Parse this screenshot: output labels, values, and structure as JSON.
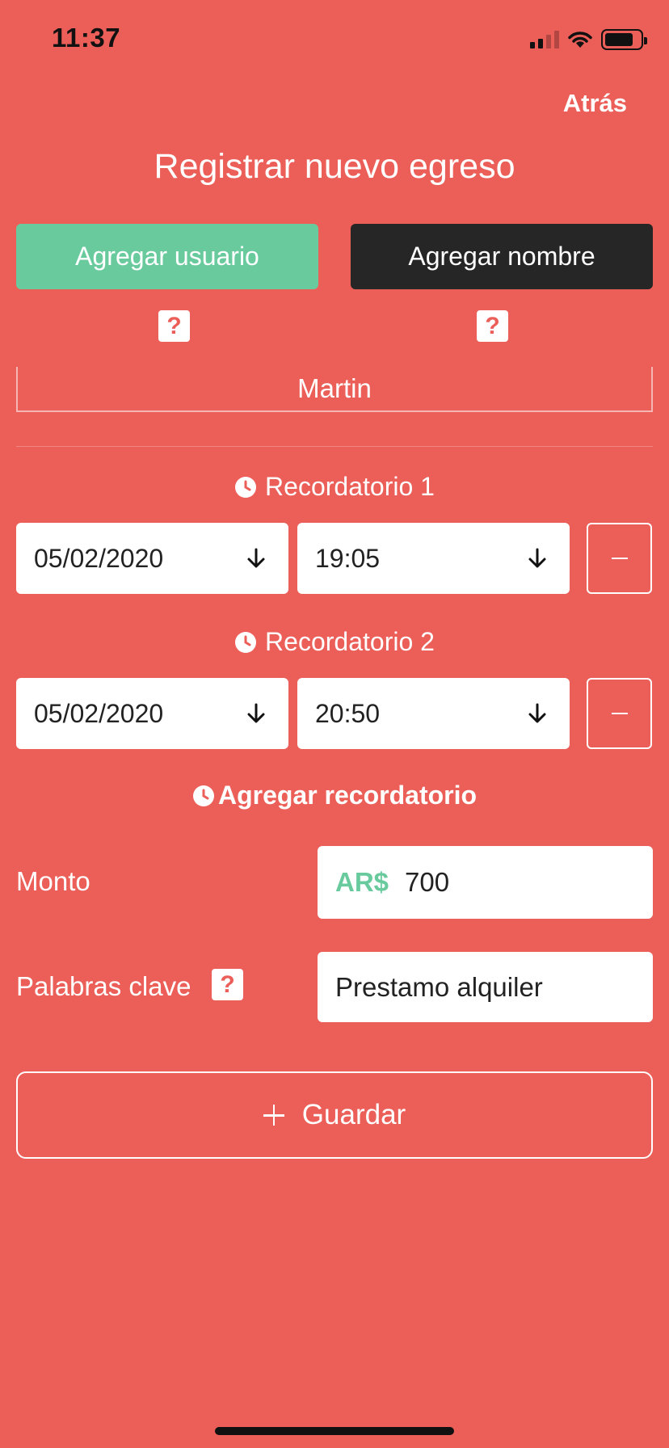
{
  "status_bar": {
    "time": "11:37"
  },
  "header": {
    "back_label": "Atrás",
    "title": "Registrar nuevo egreso"
  },
  "actions": {
    "add_user_label": "Agregar usuario",
    "add_name_label": "Agregar nombre",
    "help_glyph": "?"
  },
  "name_field": {
    "value": "Martin"
  },
  "reminders": [
    {
      "title": "Recordatorio 1",
      "date": "05/02/2020",
      "time": "19:05"
    },
    {
      "title": "Recordatorio 2",
      "date": "05/02/2020",
      "time": "20:50"
    }
  ],
  "add_reminder_label": "Agregar recordatorio",
  "amount": {
    "label": "Monto",
    "currency": "AR$",
    "value": "700"
  },
  "keywords": {
    "label": "Palabras clave",
    "value": "Prestamo alquiler"
  },
  "save_label": "Guardar",
  "colors": {
    "background": "#ec5e58",
    "accent_green": "#69cb9d",
    "dark_button": "#262626"
  },
  "icons": [
    "signal-icon",
    "wifi-icon",
    "battery-icon",
    "help-icon",
    "clock-icon",
    "arrow-down-icon",
    "minus-icon",
    "plus-icon"
  ]
}
